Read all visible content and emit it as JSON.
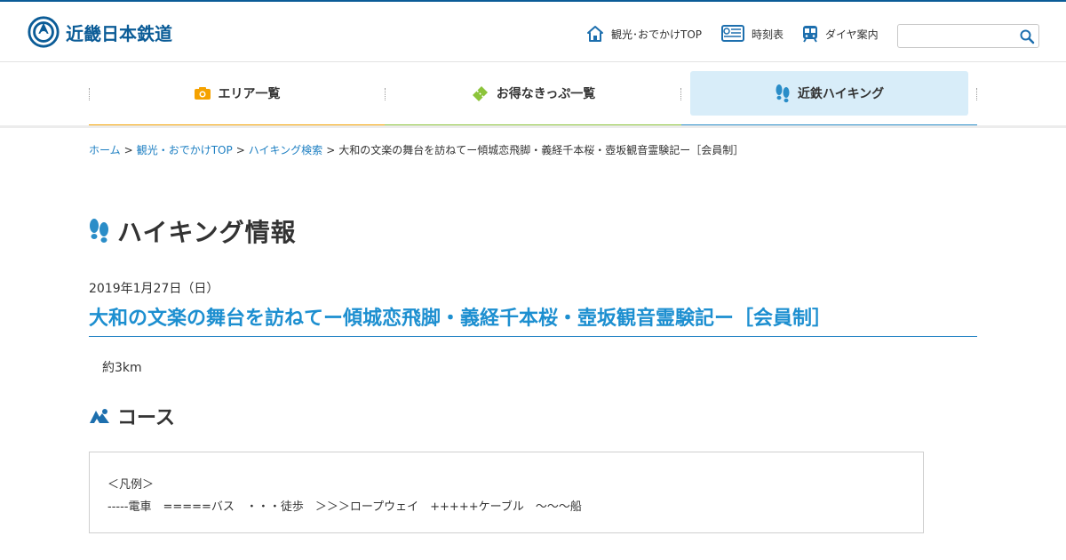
{
  "brand": {
    "name": "近畿日本鉄道"
  },
  "header_nav": [
    {
      "label": "観光･おでかけTOP",
      "icon": "home-icon"
    },
    {
      "label": "時刻表",
      "icon": "timetable-icon"
    },
    {
      "label": "ダイヤ案内",
      "icon": "train-icon"
    }
  ],
  "search": {
    "placeholder": "",
    "icon": "search-icon"
  },
  "global_nav": [
    {
      "label": "エリア一覧",
      "icon": "camera-icon",
      "color": "#f5a200"
    },
    {
      "label": "お得なきっぷ一覧",
      "icon": "ticket-icon",
      "color": "#8cc43a"
    },
    {
      "label": "近鉄ハイキング",
      "icon": "footprints-icon",
      "color": "#2a8dc8"
    }
  ],
  "breadcrumb": [
    {
      "label": "ホーム"
    },
    {
      "label": "観光・おでかけTOP"
    },
    {
      "label": "ハイキング検索"
    },
    {
      "label": "大和の文楽の舞台を訪ねてー傾城恋飛脚・義経千本桜・壺坂観音霊験記ー［会員制］"
    }
  ],
  "page": {
    "title": "ハイキング情報",
    "event_date": "2019年1月27日（日）",
    "event_title": "大和の文楽の舞台を訪ねてー傾城恋飛脚・義経千本桜・壺坂観音霊験記ー［会員制］",
    "distance": "約3km",
    "course_heading": "コース",
    "legend_title": "＜凡例＞",
    "legend_text": "-----電車　=====バス　・・・徒歩　＞＞＞ロープウェイ　+++++ケーブル　〜〜〜船"
  },
  "colors": {
    "brand": "#0b5c97",
    "link": "#1d7fc2",
    "accent_blue": "#1d8fd0"
  }
}
